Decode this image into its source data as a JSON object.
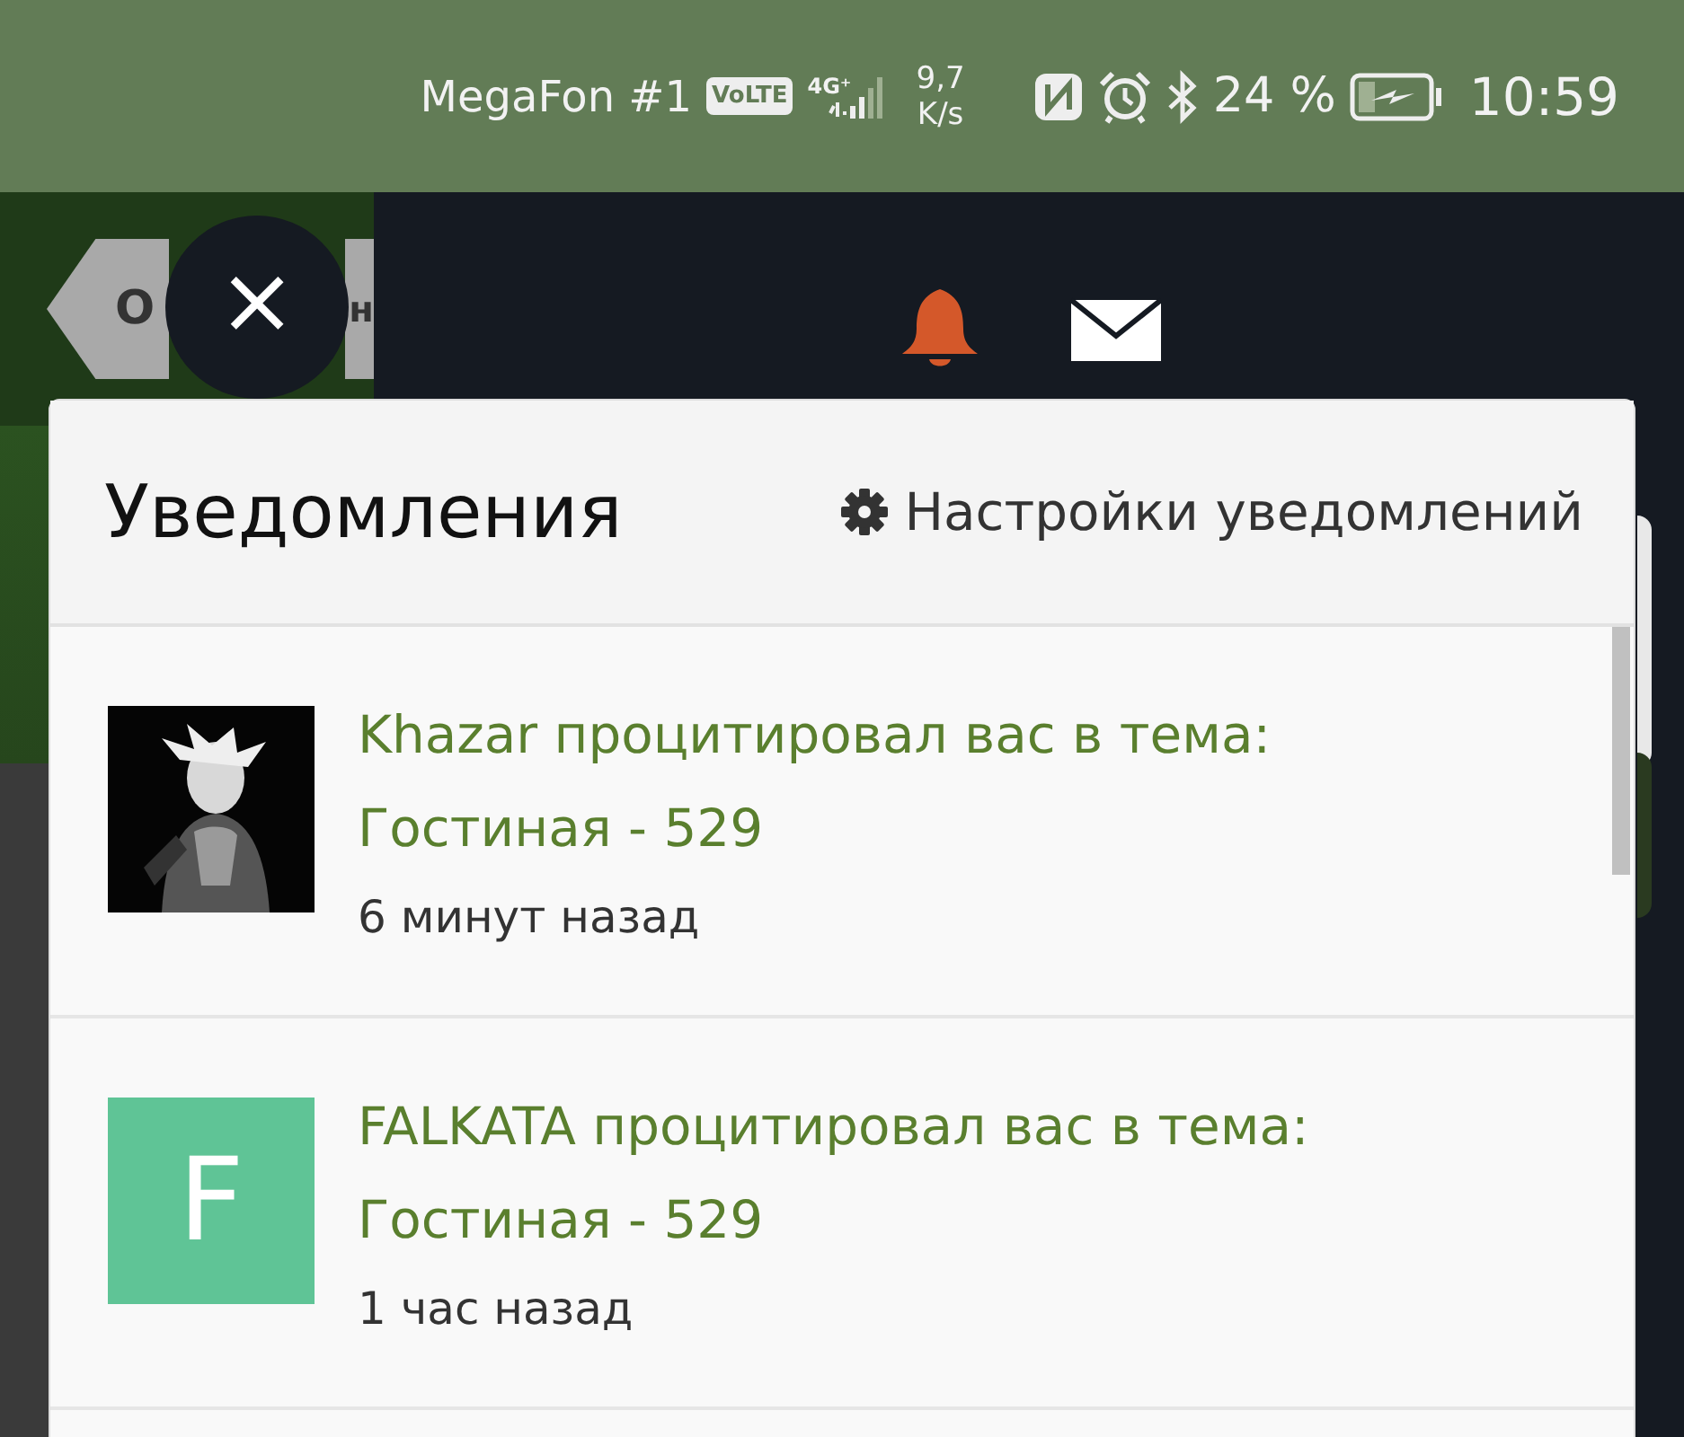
{
  "status_bar": {
    "carrier": "MegaFon #1",
    "volte": "VoLTE",
    "network": "4G⁺",
    "speed_value": "9,7",
    "speed_unit": "K/s",
    "battery_percent": "24 %",
    "charging": true,
    "time": "10:59"
  },
  "back_tag": {
    "label_start": "О",
    "label_end": "н"
  },
  "close_button": {
    "label": "×"
  },
  "header_icons": [
    {
      "kind": "bell",
      "active": true
    },
    {
      "kind": "mail",
      "active": false
    }
  ],
  "notifications_panel": {
    "title": "Уведомления",
    "settings_link": "Настройки уведомлений",
    "items": [
      {
        "text": "Khazar процитировал вас в тема: Гостиная - 529",
        "time": "6 минут назад"
      },
      {
        "avatar": {
          "kind": "letter",
          "letter": "F",
          "color": "#5fc496"
        },
        "text": "FALKATA процитировал вас в тема: Гостиная - 529",
        "time": "1 час назад"
      }
    ]
  }
}
